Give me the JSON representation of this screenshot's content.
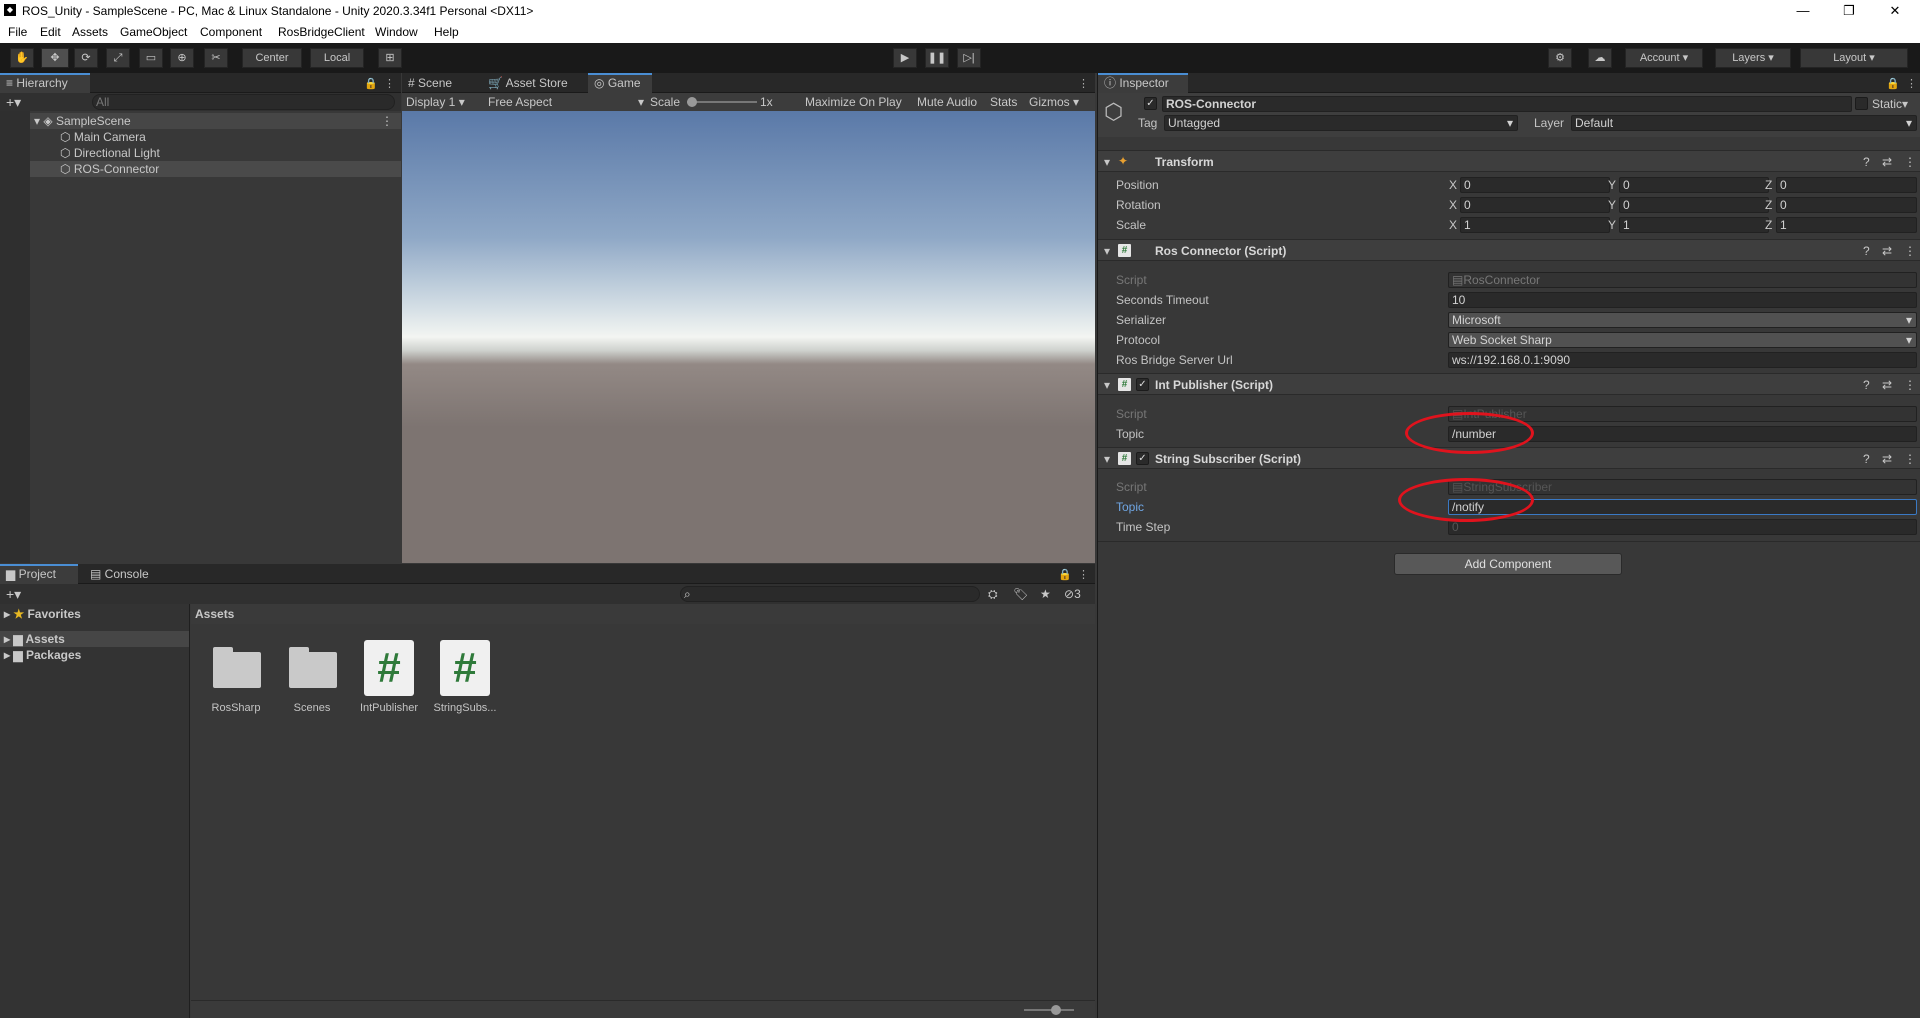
{
  "window": {
    "title": "ROS_Unity - SampleScene - PC, Mac & Linux Standalone - Unity 2020.3.34f1 Personal <DX11>"
  },
  "menu": [
    "File",
    "Edit",
    "Assets",
    "GameObject",
    "Component",
    "RosBridgeClient",
    "Window",
    "Help"
  ],
  "toolbar": {
    "center_label": "Center",
    "local_label": "Local",
    "account_label": "Account",
    "layers_label": "Layers",
    "layout_label": "Layout"
  },
  "hierarchy": {
    "tab": "Hierarchy",
    "search_placeholder": "All",
    "scene": "SampleScene",
    "items": [
      "Main Camera",
      "Directional Light",
      "ROS-Connector"
    ]
  },
  "view_tabs": {
    "scene": "Scene",
    "asset_store": "Asset Store",
    "game": "Game"
  },
  "game_bar": {
    "display": "Display 1",
    "aspect": "Free Aspect",
    "scale_label": "Scale",
    "scale_value": "1x",
    "maximize": "Maximize On Play",
    "mute": "Mute Audio",
    "stats": "Stats",
    "gizmos": "Gizmos"
  },
  "colors": {
    "sky_top": "#5a79a8",
    "horizon": "#f3f5f2",
    "ground": "#7d7471",
    "accent_ring": "#e0131d",
    "active_tab": "#4a8ed4"
  },
  "inspector": {
    "tab": "Inspector",
    "object_name": "ROS-Connector",
    "static_label": "Static",
    "tag_label": "Tag",
    "tag_value": "Untagged",
    "layer_label": "Layer",
    "layer_value": "Default",
    "transform": {
      "title": "Transform",
      "rows": [
        {
          "label": "Position",
          "x": "0",
          "y": "0",
          "z": "0"
        },
        {
          "label": "Rotation",
          "x": "0",
          "y": "0",
          "z": "0"
        },
        {
          "label": "Scale",
          "x": "1",
          "y": "1",
          "z": "1"
        }
      ],
      "axis_x": "X",
      "axis_y": "Y",
      "axis_z": "Z"
    },
    "ros_connector": {
      "title": "Ros Connector (Script)",
      "script_label": "Script",
      "script_value": "RosConnector",
      "timeout_label": "Seconds Timeout",
      "timeout_value": "10",
      "serializer_label": "Serializer",
      "serializer_value": "Microsoft",
      "protocol_label": "Protocol",
      "protocol_value": "Web Socket Sharp",
      "url_label": "Ros Bridge Server Url",
      "url_value": "ws://192.168.0.1:9090"
    },
    "int_publisher": {
      "title": "Int Publisher (Script)",
      "script_label": "Script",
      "script_value": "IntPublisher",
      "topic_label": "Topic",
      "topic_value": "/number"
    },
    "string_subscriber": {
      "title": "String Subscriber (Script)",
      "script_label": "Script",
      "script_value": "StringSubscriber",
      "topic_label": "Topic",
      "topic_value": "/notify",
      "timestep_label": "Time Step",
      "timestep_value": "0"
    },
    "add_component": "Add Component"
  },
  "project": {
    "tab_project": "Project",
    "tab_console": "Console",
    "hidden_count": "3",
    "tree": {
      "favorites": "Favorites",
      "assets": "Assets",
      "packages": "Packages"
    },
    "breadcrumb": "Assets",
    "assets": [
      {
        "name": "RosSharp",
        "icon": "folder-icon"
      },
      {
        "name": "Scenes",
        "icon": "folder-icon"
      },
      {
        "name": "IntPublisher",
        "icon": "csharp-script-icon"
      },
      {
        "name": "StringSubs...",
        "icon": "csharp-script-icon"
      }
    ]
  }
}
